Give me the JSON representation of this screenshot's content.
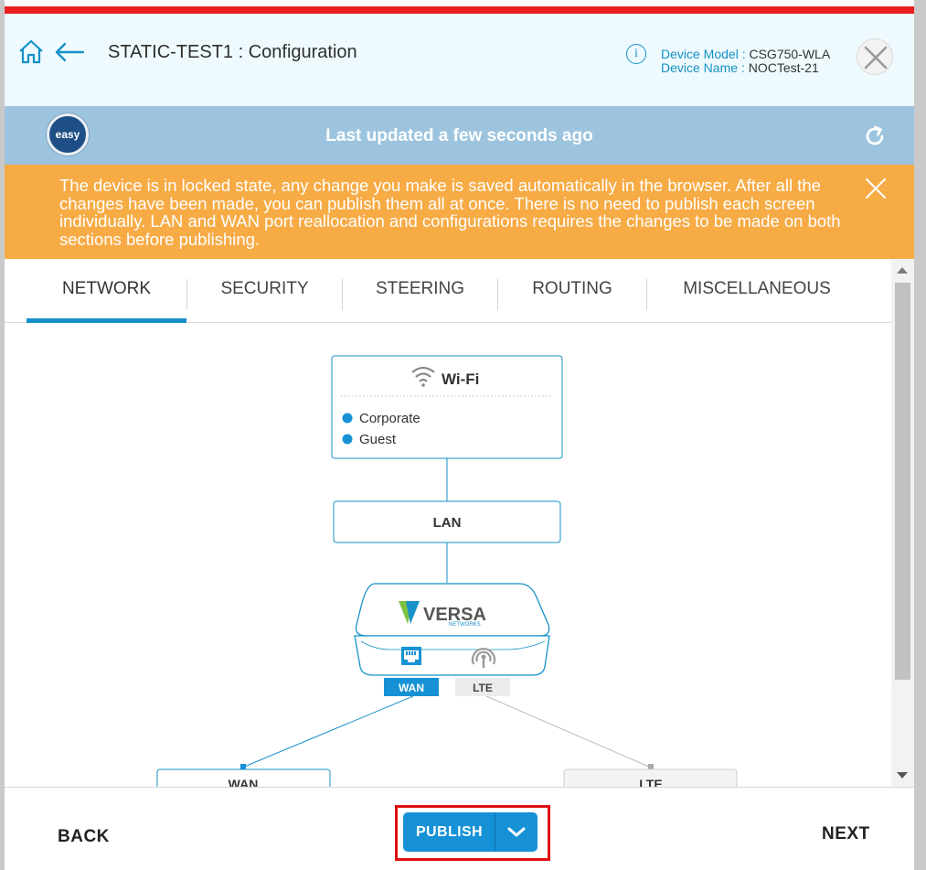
{
  "header": {
    "title": "STATIC-TEST1 : Configuration",
    "info_icon_glyph": "i",
    "device_model_label": "Device Model :",
    "device_model_value": "CSG750-WLA",
    "device_name_label": "Device Name :",
    "device_name_value": "NOCTest-21",
    "accent_color": "#1691c9"
  },
  "status": {
    "logo_text": "easy",
    "last_updated": "Last updated a few seconds ago"
  },
  "alert": {
    "message": "The device is in locked state, any change you make is saved automatically in the browser. After all the changes have been made, you can publish them all at once. There is no need to publish each screen individually. LAN and WAN port reallocation and configurations requires the changes to be made on both sections before publishing.",
    "color": "#f7ab45"
  },
  "tabs": [
    {
      "label": "NETWORK",
      "active": true
    },
    {
      "label": "SECURITY",
      "active": false
    },
    {
      "label": "STEERING",
      "active": false
    },
    {
      "label": "ROUTING",
      "active": false
    },
    {
      "label": "MISCELLANEOUS",
      "active": false
    }
  ],
  "diagram": {
    "wifi_title": "Wi-Fi",
    "ssids": [
      "Corporate",
      "Guest"
    ],
    "lan_label": "LAN",
    "device_brand": "VERSA",
    "device_brand_sub": "NETWORKS",
    "wan_port_label": "WAN",
    "lte_port_label": "LTE",
    "wan_box_label": "WAN",
    "lte_box_label": "LTE"
  },
  "footer": {
    "back_label": "BACK",
    "publish_label": "PUBLISH",
    "next_label": "NEXT"
  }
}
